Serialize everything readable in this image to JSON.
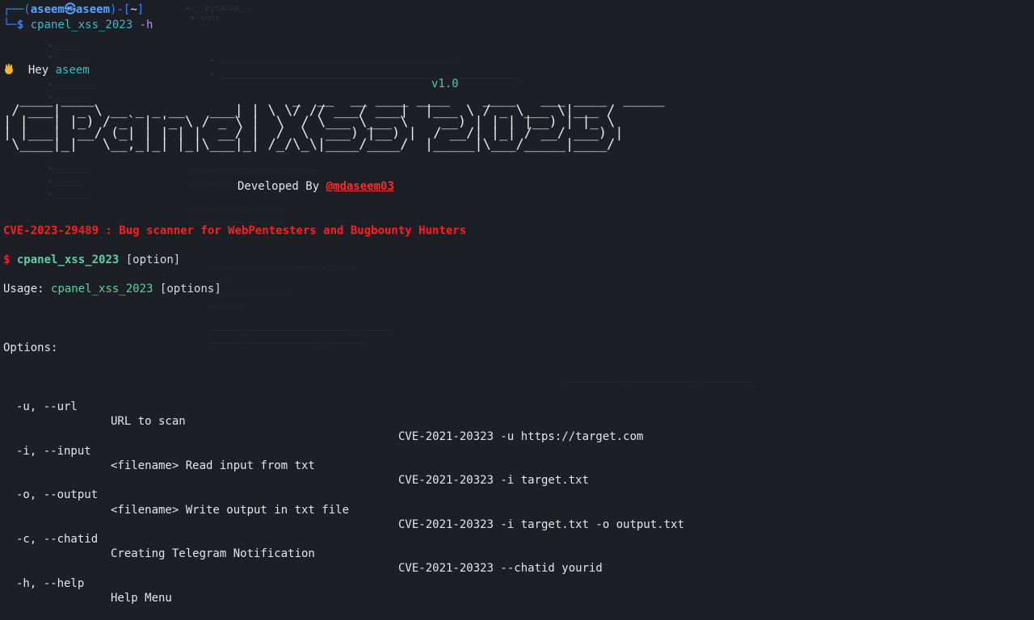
{
  "terminal": {
    "prompt_user": "aseem",
    "prompt_host": "aseem",
    "prompt_dir": "~",
    "command": "cpanel_xss_2023",
    "command_flag": "-h",
    "greeting_prefix": "Hey",
    "greeting_name": "aseem",
    "version": "v1.0",
    "ascii_banner": "  ____ ____                        _  __  __ ____ ____    ____   ___ ____  _____ \n / ___|  _ \\ __ _ _ __   ___| | \\ \\/ // ___/ ___|  |___ \\ / _ \\___ \\|___ / \n| |   | |_) / _` | '_ \\ / _ \\ |  \\  / \\___ \\___ \\    __) | | | |__) | |_ \\ \n| |___|  __/ (_| | | | |  __/ |  /  \\  ___) |__) |  / __/| |_| / __/ ___) |\n \\____|_|   \\__,_|_| |_|\\___|_| /_/\\_\\|____/____/  |_____|\\___/_____|____/ ",
    "developed_by": "Developed By",
    "author": "@mdaseem03",
    "cve_title": "CVE-2023-29489 : Bug scanner for WebPentesters and Bugbounty Hunters",
    "usage_dollar": "$",
    "usage_cmd": "cpanel_xss_2023",
    "usage_arg": "[option]",
    "usage_label": "Usage:",
    "usage_cmd2": "cpanel_xss_2023",
    "usage_arg2": "[options]",
    "options_label": "Options:",
    "options": [
      {
        "flag": "-u, --url",
        "desc": "URL to scan",
        "example": "CVE-2021-20323 -u https://target.com"
      },
      {
        "flag": "-i, --input",
        "desc": "<filename> Read input from txt",
        "example": "CVE-2021-20323 -i target.txt"
      },
      {
        "flag": "-o, --output",
        "desc": "<filename> Write output in txt file",
        "example": "CVE-2021-20323 -i target.txt -o output.txt"
      },
      {
        "flag": "-c, --chatid",
        "desc": "Creating Telegram Notification",
        "example": "CVE-2021-20323 --chatid yourid"
      },
      {
        "flag": "-h, --help",
        "desc": "Help Menu",
        "example": ""
      }
    ]
  },
  "colors": {
    "background": "#1c1f26",
    "prompt_box": "#3b82f6",
    "accent_cyan": "#3fb8c9",
    "title_red": "#ff1f1f",
    "command_green": "#5fd0a0"
  }
}
